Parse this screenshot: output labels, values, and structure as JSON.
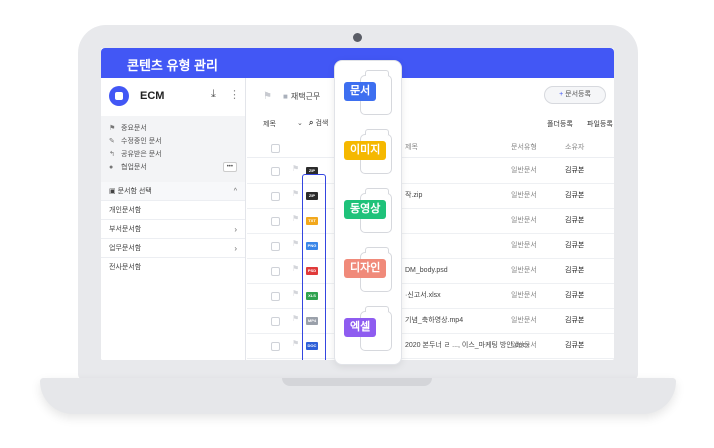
{
  "window": {
    "title": "콘텐츠 유형 관리"
  },
  "sidebar": {
    "brand": "ECM",
    "quick": [
      {
        "icon": "flag-icon",
        "label": "중요문서"
      },
      {
        "icon": "edit-icon",
        "label": "수정중인 문서"
      },
      {
        "icon": "share-icon",
        "label": "공유받은 문서"
      },
      {
        "icon": "user-icon",
        "label": "협업문서"
      }
    ],
    "more_label": "•••",
    "section": "문서함 선택",
    "items": [
      {
        "label": "개인문서함"
      },
      {
        "label": "부서문서함"
      },
      {
        "label": "업무문서함"
      },
      {
        "label": "전사문서함"
      }
    ]
  },
  "main": {
    "breadcrumb": "재택근무",
    "register_button": "문서등록",
    "sort_label": "제목",
    "search_label": "검색",
    "folder_register": "폴더등록",
    "file_register": "파일등록",
    "columns": {
      "title": "제목",
      "type": "문서유형",
      "owner": "소유자"
    },
    "rows": [
      {
        "badge": "ZIP",
        "badge_color": "#2b2b2b",
        "name": "",
        "type": "일반문서",
        "owner": "김큐본"
      },
      {
        "badge": "ZIP",
        "badge_color": "#2b2b2b",
        "name": "작.zip",
        "type": "일반문서",
        "owner": "김큐본"
      },
      {
        "badge": "TXT",
        "badge_color": "#f2a81d",
        "name": "",
        "type": "일반문서",
        "owner": "김큐본"
      },
      {
        "badge": "PNG",
        "badge_color": "#3a86e8",
        "name": "",
        "type": "일반문서",
        "owner": "김큐본"
      },
      {
        "badge": "PSD",
        "badge_color": "#e03a3a",
        "name": "DM_body.psd",
        "type": "일반문서",
        "owner": "김큐본"
      },
      {
        "badge": "XLS",
        "badge_color": "#2fa24f",
        "name": "·신고서.xlsx",
        "type": "일반문서",
        "owner": "김큐본"
      },
      {
        "badge": "MP4",
        "badge_color": "#9aa0aa",
        "name": "기념_축하영상.mp4",
        "type": "일반문서",
        "owner": "김큐본"
      },
      {
        "badge": "DOC",
        "badge_color": "#2d5fd8",
        "name": "2020 본두너 ㄹ ..., 이스_마케팅 방안.docx",
        "type": "일반문서",
        "owner": "김큐본"
      }
    ]
  },
  "content_types": [
    {
      "label": "문서",
      "color": "#3d6ff0"
    },
    {
      "label": "이미지",
      "color": "#f5b800"
    },
    {
      "label": "동영상",
      "color": "#1fc27a"
    },
    {
      "label": "디자인",
      "color": "#f08a7a"
    },
    {
      "label": "엑셀",
      "color": "#8e5cf0"
    }
  ],
  "colors": {
    "accent": "#4257f5"
  }
}
